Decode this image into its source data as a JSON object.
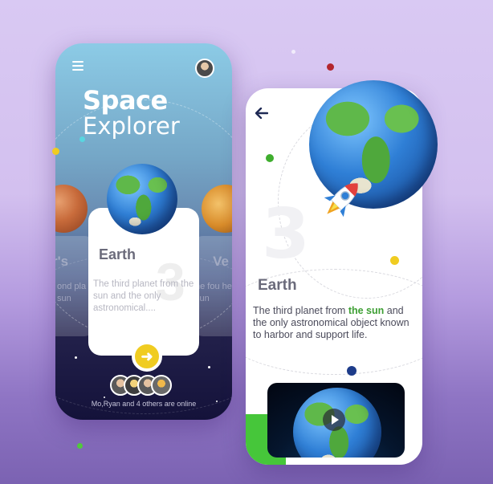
{
  "left_screen": {
    "title_line1": "Space",
    "title_line2": "Explorer",
    "menu_icon": "hamburger-icon",
    "avatar_icon": "user-avatar",
    "current_planet": {
      "name": "Earth",
      "number": "3",
      "description": "The third planet from the sun and the only astronomical...."
    },
    "prev_planet": {
      "name_fragment": "r's",
      "desc_fragment": "ond pla sun"
    },
    "next_planet": {
      "name_fragment": "Ve",
      "desc_fragment": "he fou he sun"
    },
    "go_button_icon": "arrow-right-icon",
    "online_text": "Mo,Ryan and 4 others  are online"
  },
  "right_screen": {
    "back_icon": "arrow-left-icon",
    "planet_number": "3",
    "planet_name": "Earth",
    "description_before": "The third planet from ",
    "description_highlight": "the sun",
    "description_after": " and the only astronomical object known to harbor and support life.",
    "video_icon": "play-icon"
  },
  "colors": {
    "accent_yellow": "#f0cc21",
    "accent_green": "#46c63a",
    "highlight_green": "#3d9f33",
    "navy": "#14123a"
  }
}
